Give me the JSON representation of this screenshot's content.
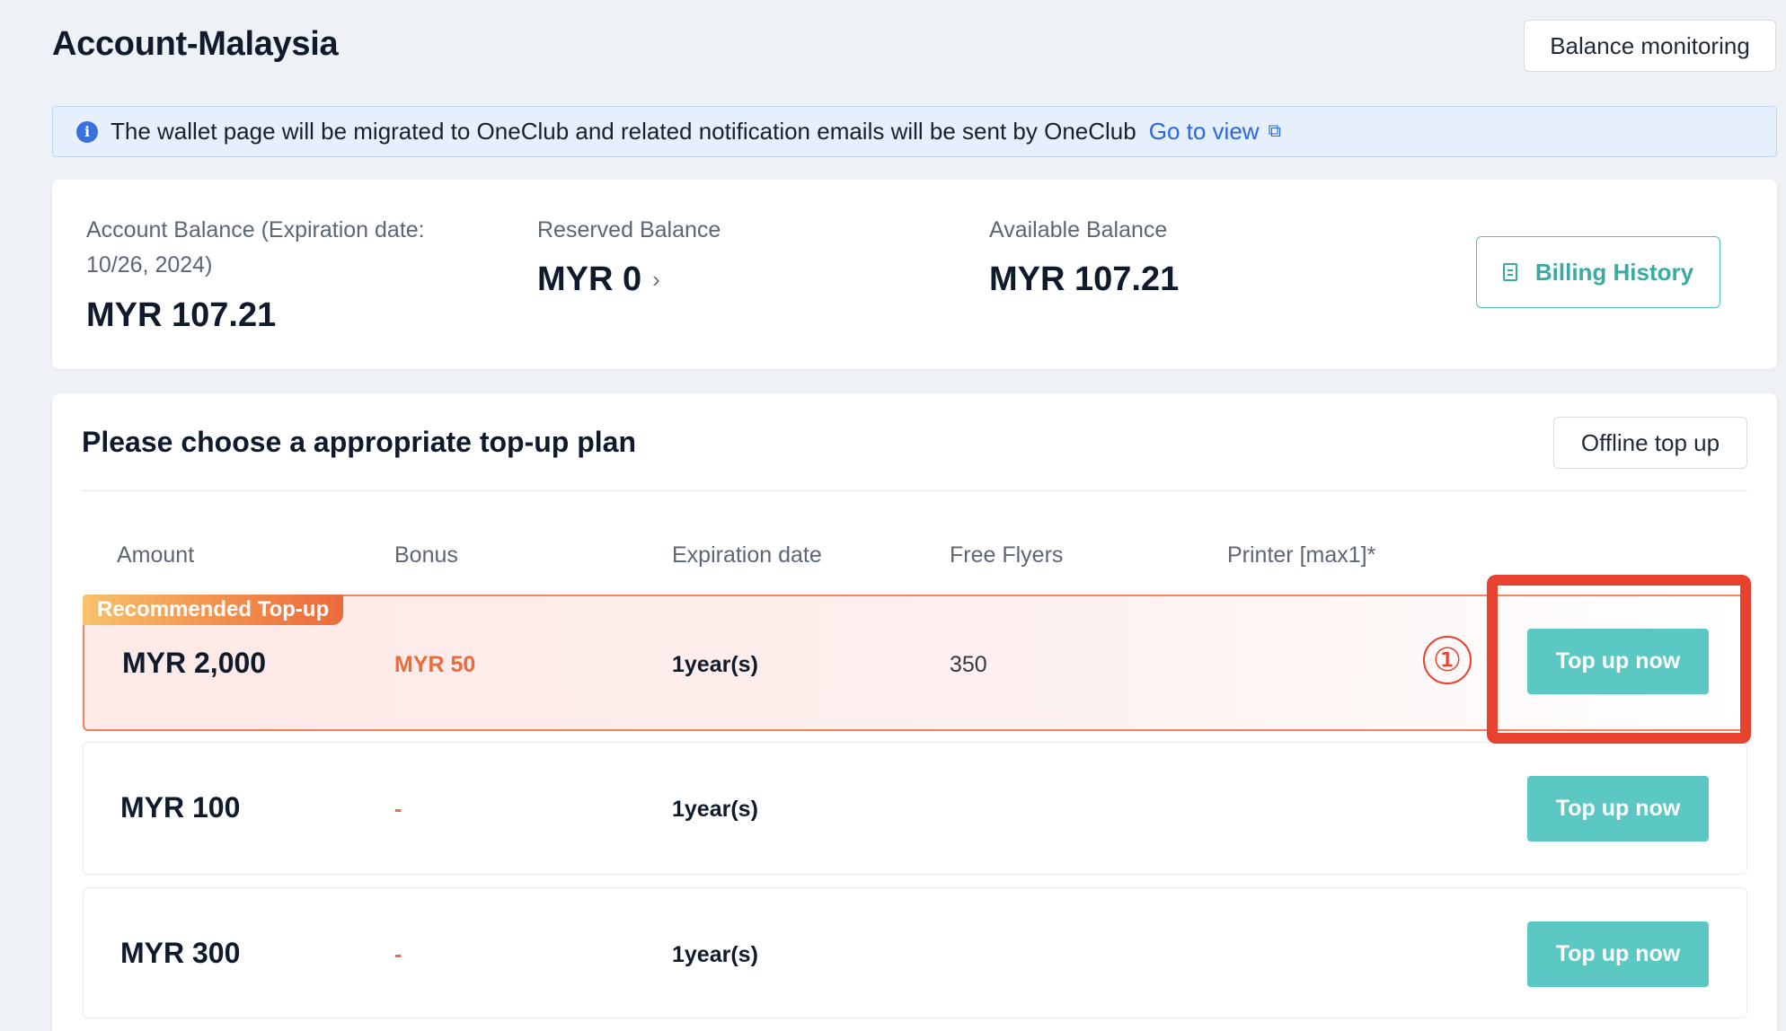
{
  "header": {
    "title": "Account-Malaysia",
    "balance_monitoring_label": "Balance monitoring"
  },
  "notice": {
    "text": "The wallet page will be migrated to OneClub and related notification emails will be sent by OneClub",
    "link_label": "Go to view"
  },
  "balance": {
    "account_label": "Account Balance (Expiration date: 10/26, 2024)",
    "account_value": "MYR 107.21",
    "reserved_label": "Reserved Balance",
    "reserved_value": "MYR 0",
    "available_label": "Available Balance",
    "available_value": "MYR 107.21",
    "billing_history_label": "Billing History"
  },
  "plans": {
    "title": "Please choose a appropriate top-up plan",
    "offline_label": "Offline top up",
    "columns": [
      "Amount",
      "Bonus",
      "Expiration date",
      "Free Flyers",
      "Printer [max1]*"
    ],
    "recommended_badge": "Recommended Top-up",
    "rows": [
      {
        "amount": "MYR 2,000",
        "bonus": "MYR 50",
        "expiration": "1year(s)",
        "flyers": "350",
        "button": "Top up now"
      },
      {
        "amount": "MYR 100",
        "bonus": "-",
        "expiration": "1year(s)",
        "flyers": "",
        "button": "Top up now"
      },
      {
        "amount": "MYR 300",
        "bonus": "-",
        "expiration": "1year(s)",
        "flyers": "",
        "button": "Top up now"
      }
    ]
  },
  "annotation": {
    "step_marker": "①"
  },
  "colors": {
    "accent_teal": "#5bc8c3",
    "highlight_red": "#e8412d",
    "bonus_orange": "#ee6a3a",
    "link_blue": "#2b66e3"
  }
}
